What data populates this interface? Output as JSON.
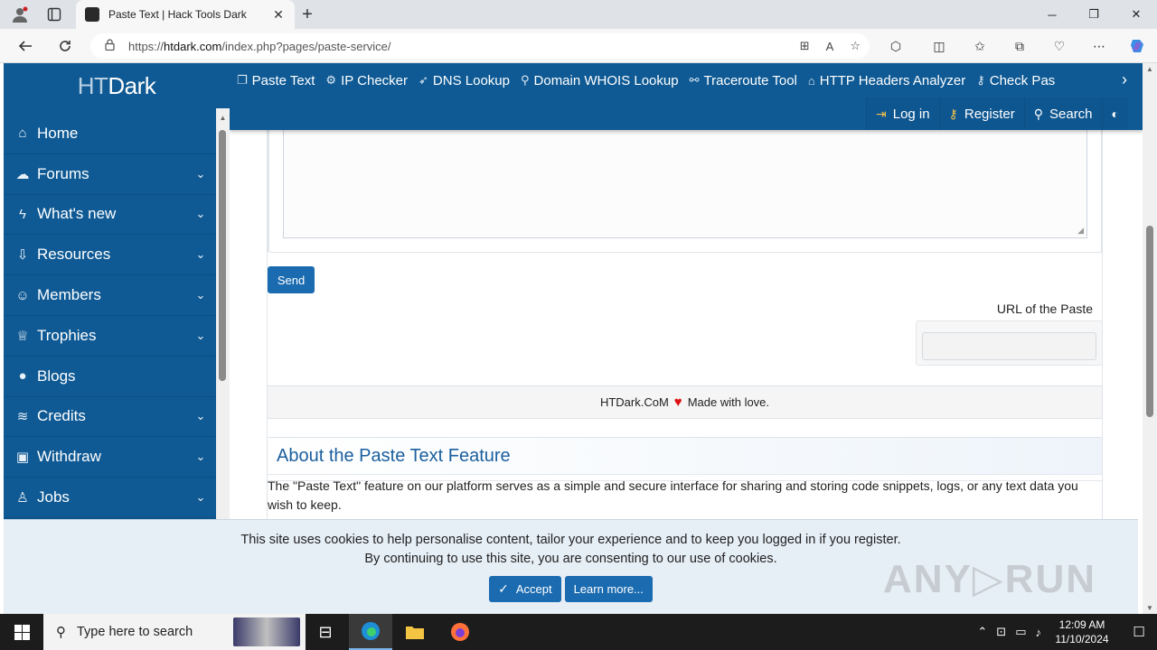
{
  "browser": {
    "tab_title": "Paste Text | Hack Tools Dark",
    "tab_close": "✕",
    "new_tab": "+",
    "minimize": "─",
    "maximize": "❐",
    "close": "✕",
    "url_prefix": "https://",
    "url_host": "htdark.com",
    "url_path": "/index.php?pages/paste-service/"
  },
  "site": {
    "logo_part1": "HT",
    "logo_part2": "Dark"
  },
  "sidebar": {
    "items": [
      {
        "label": "Home",
        "icon": "⌂",
        "has_chevron": false
      },
      {
        "label": "Forums",
        "icon": "☁",
        "has_chevron": true
      },
      {
        "label": "What's new",
        "icon": "ϟ",
        "has_chevron": true
      },
      {
        "label": "Resources",
        "icon": "⇩",
        "has_chevron": true
      },
      {
        "label": "Members",
        "icon": "☺",
        "has_chevron": true
      },
      {
        "label": "Trophies",
        "icon": "♕",
        "has_chevron": true
      },
      {
        "label": "Blogs",
        "icon": "●",
        "has_chevron": false
      },
      {
        "label": "Credits",
        "icon": "≋",
        "has_chevron": true
      },
      {
        "label": "Withdraw",
        "icon": "▣",
        "has_chevron": true
      },
      {
        "label": "Jobs",
        "icon": "♙",
        "has_chevron": true
      }
    ],
    "chevron": "⌄"
  },
  "topnav": {
    "links": [
      {
        "label": "Paste Text",
        "icon": "❐"
      },
      {
        "label": "IP Checker",
        "icon": "⚙"
      },
      {
        "label": "DNS Lookup",
        "icon": "➶"
      },
      {
        "label": "Domain WHOIS Lookup",
        "icon": "⚲"
      },
      {
        "label": "Traceroute Tool",
        "icon": "⚯"
      },
      {
        "label": "HTTP Headers Analyzer",
        "icon": "⌂"
      },
      {
        "label": "Check Pas",
        "icon": "⚷"
      }
    ],
    "more": "›",
    "login": "Log in",
    "register": "Register",
    "search": "Search",
    "login_icon": "⇥",
    "register_icon": "⚷",
    "search_icon": "⚲",
    "theme_icon": "◐"
  },
  "paste": {
    "send_label": "Send",
    "url_label": "URL of the Paste",
    "url_value": "",
    "resize_grip": "◢"
  },
  "footer": {
    "brand": "HTDark.CoM",
    "heart": "♥",
    "tagline": "Made with love."
  },
  "about": {
    "title": "About the Paste Text Feature",
    "body": "The \"Paste Text\" feature on our platform serves as a simple and secure interface for sharing and storing code snippets, logs, or any text data you wish to keep."
  },
  "cookie": {
    "line1": "This site uses cookies to help personalise content, tailor your experience and to keep you logged in if you register.",
    "line2": "By continuing to use this site, you are consenting to our use of cookies.",
    "accept": "Accept",
    "learn_more": "Learn more...",
    "check_icon": "✓"
  },
  "watermark": "ANY▷RUN",
  "taskbar": {
    "search_placeholder": "Type here to search",
    "time": "12:09 AM",
    "date": "11/10/2024"
  }
}
